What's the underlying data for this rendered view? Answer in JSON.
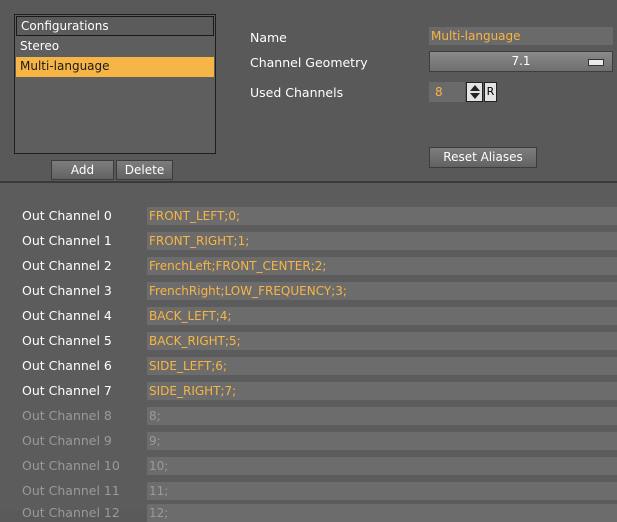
{
  "configurations": {
    "header": "Configurations",
    "items": [
      {
        "label": "Stereo",
        "selected": false
      },
      {
        "label": "Multi-language",
        "selected": true
      }
    ],
    "add_label": "Add",
    "delete_label": "Delete"
  },
  "properties": {
    "name_label": "Name",
    "name_value": "Multi-language",
    "geometry_label": "Channel Geometry",
    "geometry_value": "7.1",
    "used_label": "Used Channels",
    "used_value": "8",
    "reset_r_label": "R",
    "reset_aliases_label": "Reset Aliases"
  },
  "channels": [
    {
      "label": "Out Channel 0",
      "value": "FRONT_LEFT;0;",
      "active": true
    },
    {
      "label": "Out Channel 1",
      "value": "FRONT_RIGHT;1;",
      "active": true
    },
    {
      "label": "Out Channel 2",
      "value": "FrenchLeft;FRONT_CENTER;2;",
      "active": true
    },
    {
      "label": "Out Channel 3",
      "value": "FrenchRight;LOW_FREQUENCY;3;",
      "active": true
    },
    {
      "label": "Out Channel 4",
      "value": "BACK_LEFT;4;",
      "active": true
    },
    {
      "label": "Out Channel 5",
      "value": "BACK_RIGHT;5;",
      "active": true
    },
    {
      "label": "Out Channel 6",
      "value": "SIDE_LEFT;6;",
      "active": true
    },
    {
      "label": "Out Channel 7",
      "value": "SIDE_RIGHT;7;",
      "active": true
    },
    {
      "label": "Out Channel 8",
      "value": "8;",
      "active": false
    },
    {
      "label": "Out Channel 9",
      "value": "9;",
      "active": false
    },
    {
      "label": "Out Channel 10",
      "value": "10;",
      "active": false
    },
    {
      "label": "Out Channel 11",
      "value": "11;",
      "active": false
    },
    {
      "label": "Out Channel 12",
      "value": "12;",
      "active": false
    }
  ],
  "colors": {
    "accent": "#f7b545",
    "background": "#5a5a5a",
    "inactive_text": "#9a9a9a"
  }
}
